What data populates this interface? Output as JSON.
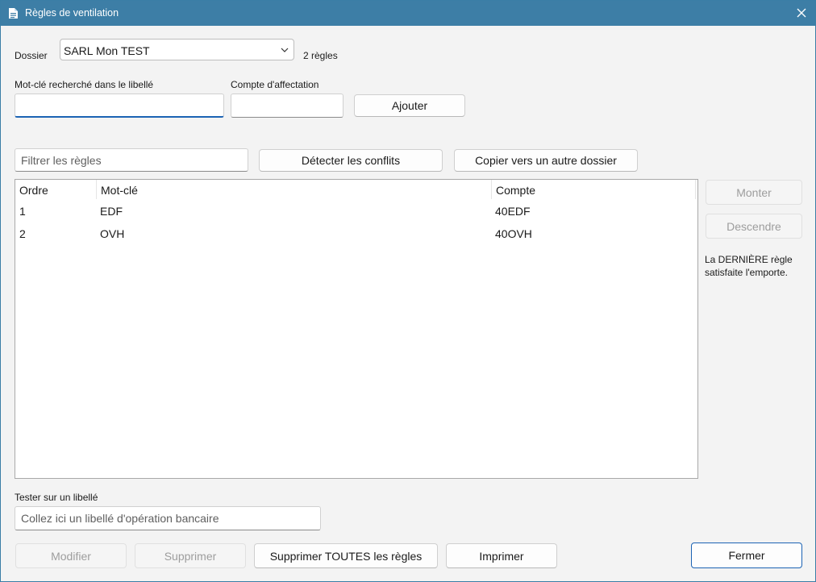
{
  "window": {
    "title": "Règles de ventilation",
    "icons": {
      "app": "document-icon",
      "close": "close-icon"
    }
  },
  "dossier": {
    "label": "Dossier",
    "selected": "SARL Mon TEST",
    "count": "2 règles"
  },
  "keyword": {
    "label": "Mot-clé recherché dans le libellé",
    "value": ""
  },
  "account": {
    "label": "Compte d'affectation",
    "value": ""
  },
  "add_button": "Ajouter",
  "filter": {
    "placeholder": "Filtrer les règles"
  },
  "detect_button": "Détecter les conflits",
  "copy_button": "Copier vers un autre dossier",
  "table": {
    "columns": [
      "Ordre",
      "Mot-clé",
      "Compte"
    ],
    "rows": [
      {
        "order": "1",
        "keyword": "EDF",
        "account": "40EDF"
      },
      {
        "order": "2",
        "keyword": "OVH",
        "account": "40OVH"
      }
    ]
  },
  "side": {
    "up_button": "Monter",
    "down_button": "Descendre",
    "note_line1": "La DERNIÈRE règle",
    "note_line2": "satisfaite l'emporte."
  },
  "test": {
    "label": "Tester sur un libellé",
    "placeholder": "Collez ici un libellé d'opération bancaire"
  },
  "footer": {
    "modify": "Modifier",
    "delete": "Supprimer",
    "delete_all": "Supprimer TOUTES les règles",
    "print": "Imprimer",
    "close": "Fermer"
  },
  "colors": {
    "titlebar": "#3d7ea6",
    "accent": "#1c63b4"
  }
}
